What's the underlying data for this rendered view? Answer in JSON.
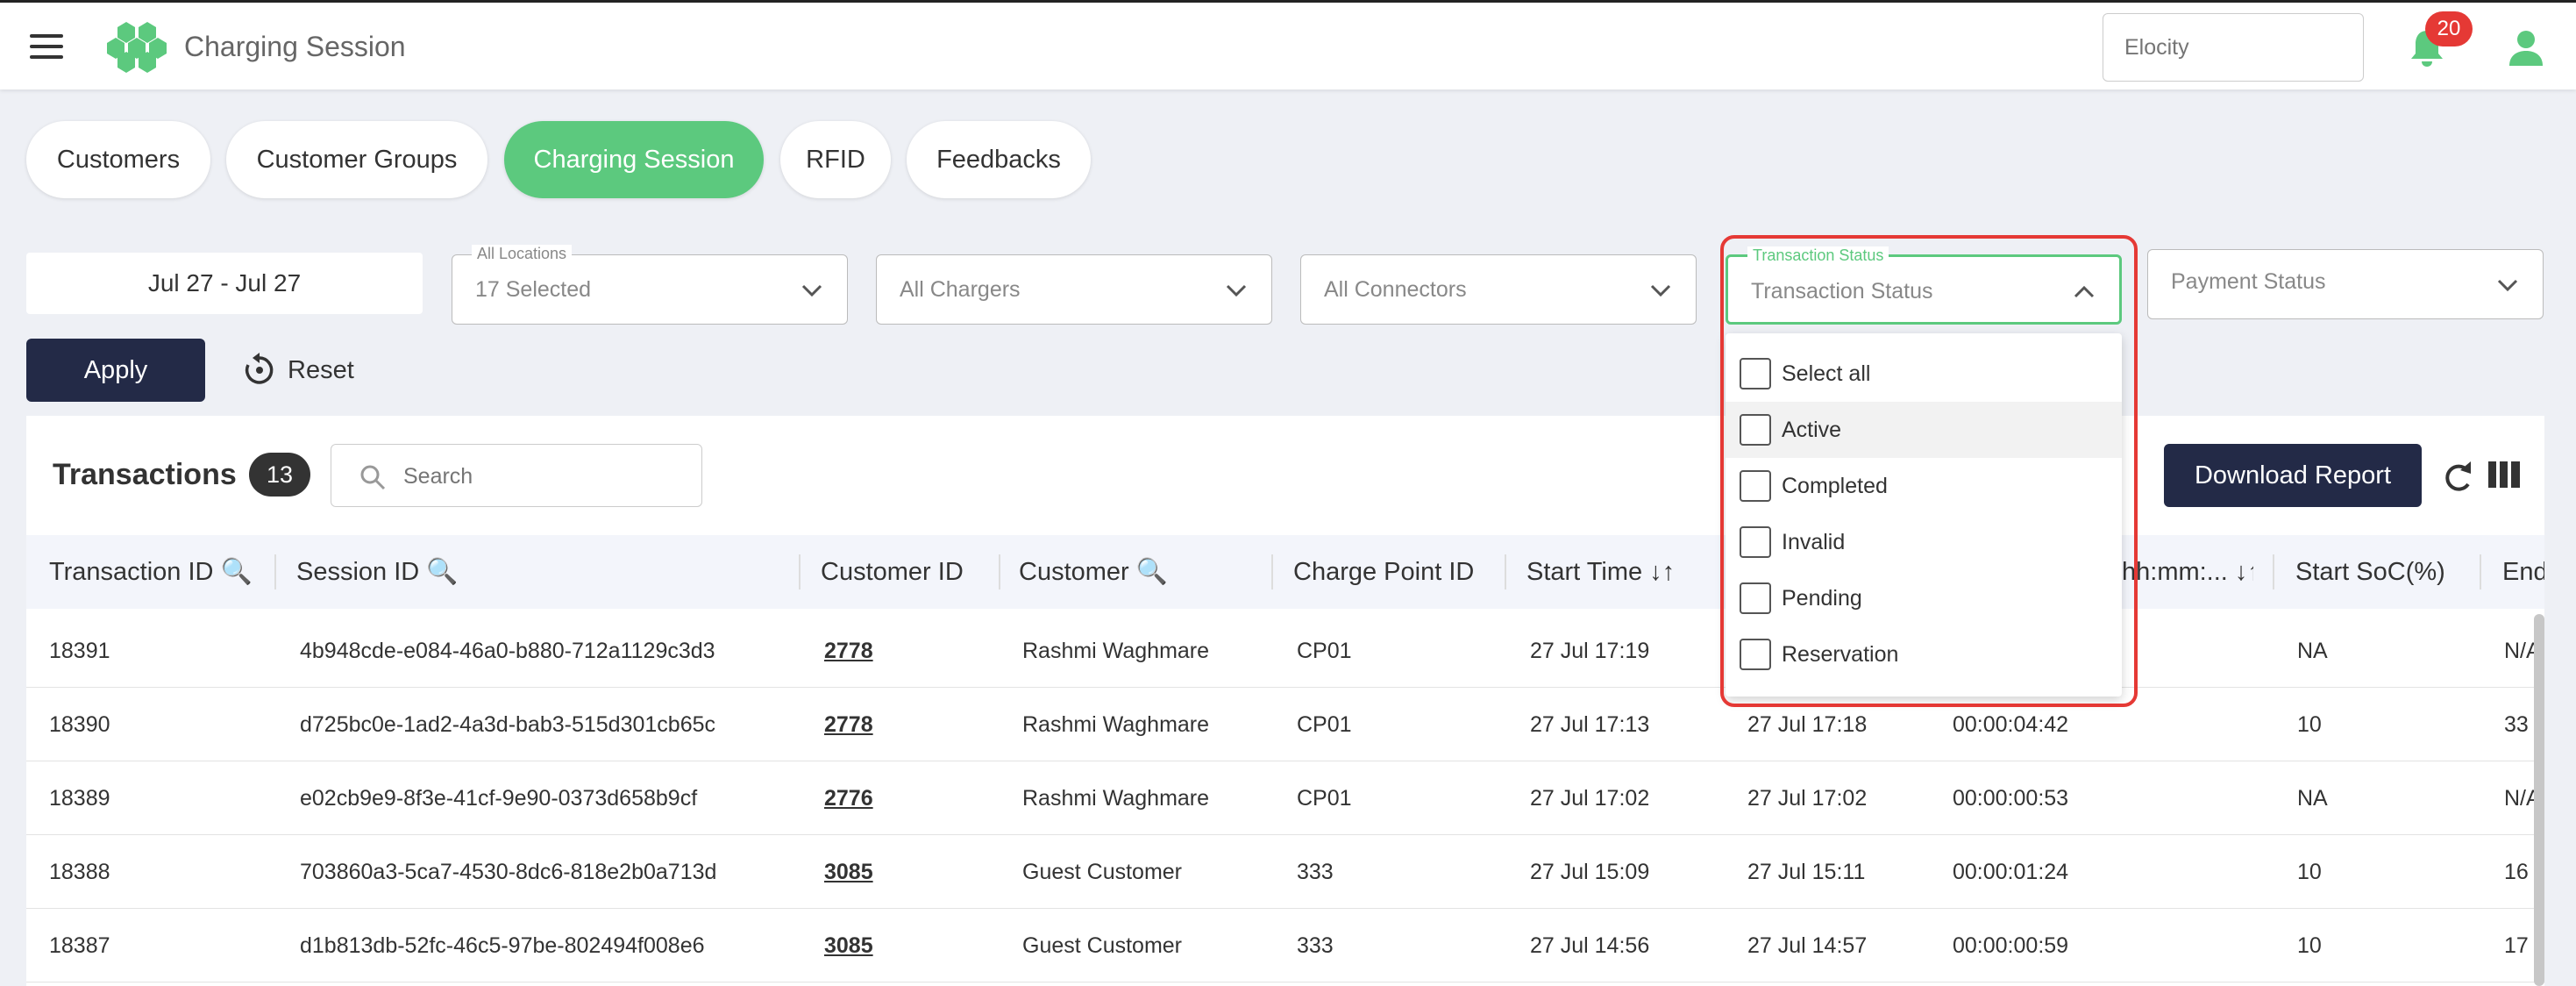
{
  "header": {
    "title": "Charging Session",
    "org_placeholder": "Elocity",
    "notification_count": "20",
    "icons": [
      "menu-icon",
      "logo-icon",
      "bell-icon",
      "user-icon"
    ]
  },
  "tabs": [
    {
      "label": "Customers"
    },
    {
      "label": "Customer Groups"
    },
    {
      "label": "Charging Session",
      "active": true
    },
    {
      "label": "RFID"
    },
    {
      "label": "Feedbacks"
    }
  ],
  "filters": {
    "date_range": "Jul 27 - Jul 27",
    "locations": {
      "label": "All Locations",
      "value": "17 Selected"
    },
    "chargers": {
      "value": "All Chargers"
    },
    "connectors": {
      "value": "All Connectors"
    },
    "transaction_status": {
      "label": "Transaction Status",
      "placeholder": "Transaction Status"
    },
    "payment_status": {
      "value": "Payment Status"
    },
    "apply_label": "Apply",
    "reset_label": "Reset"
  },
  "status_dropdown": {
    "options": [
      "Select all",
      "Active",
      "Completed",
      "Invalid",
      "Pending",
      "Reservation"
    ],
    "hovered": "Active"
  },
  "transactions": {
    "title": "Transactions",
    "count": "13",
    "search_placeholder": "Search",
    "download_label": "Download Report",
    "columns": [
      "Transaction ID",
      "Session ID",
      "Customer ID",
      "Customer",
      "Charge Point ID",
      "Start Time",
      "hh:mm:...",
      "Start SoC(%)",
      "End"
    ],
    "rows": [
      {
        "transaction_id": "18391",
        "session_id": "4b948cde-e084-46a0-b880-712a1129c3d3",
        "customer_id": "2778",
        "customer": "Rashmi Waghmare",
        "charge_point_id": "CP01",
        "start_time": "27 Jul 17:19",
        "end_time": "",
        "duration": "",
        "start_soc": "NA",
        "end_soc": "N/A"
      },
      {
        "transaction_id": "18390",
        "session_id": "d725bc0e-1ad2-4a3d-bab3-515d301cb65c",
        "customer_id": "2778",
        "customer": "Rashmi Waghmare",
        "charge_point_id": "CP01",
        "start_time": "27 Jul 17:13",
        "end_time": "27 Jul 17:18",
        "duration": "00:00:04:42",
        "start_soc": "10",
        "end_soc": "33"
      },
      {
        "transaction_id": "18389",
        "session_id": "e02cb9e9-8f3e-41cf-9e90-0373d658b9cf",
        "customer_id": "2776",
        "customer": "Rashmi Waghmare",
        "charge_point_id": "CP01",
        "start_time": "27 Jul 17:02",
        "end_time": "27 Jul 17:02",
        "duration": "00:00:00:53",
        "start_soc": "NA",
        "end_soc": "N/A"
      },
      {
        "transaction_id": "18388",
        "session_id": "703860a3-5ca7-4530-8dc6-818e2b0a713d",
        "customer_id": "3085",
        "customer": "Guest Customer",
        "charge_point_id": "333",
        "start_time": "27 Jul 15:09",
        "end_time": "27 Jul 15:11",
        "duration": "00:00:01:24",
        "start_soc": "10",
        "end_soc": "16"
      },
      {
        "transaction_id": "18387",
        "session_id": "d1b813db-52fc-46c5-97be-802494f008e6",
        "customer_id": "3085",
        "customer": "Guest Customer",
        "charge_point_id": "333",
        "start_time": "27 Jul 14:56",
        "end_time": "27 Jul 14:57",
        "duration": "00:00:00:59",
        "start_soc": "10",
        "end_soc": "17"
      }
    ]
  },
  "colors": {
    "accent": "#5cc97e",
    "primary_button": "#232a47",
    "badge": "#e53935",
    "highlight": "#e53935"
  }
}
